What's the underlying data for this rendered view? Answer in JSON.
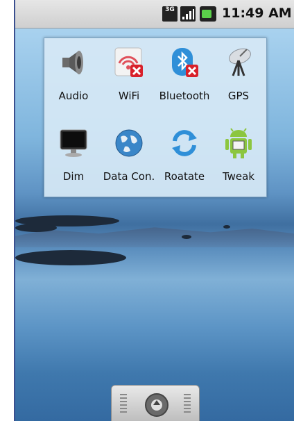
{
  "status_bar": {
    "network": "3G",
    "time": "11:49 AM"
  },
  "widget": {
    "tiles": [
      {
        "label": "Audio",
        "icon": "speaker-icon"
      },
      {
        "label": "WiFi",
        "icon": "wifi-icon"
      },
      {
        "label": "Bluetooth",
        "icon": "bluetooth-icon"
      },
      {
        "label": "GPS",
        "icon": "satellite-dish-icon"
      },
      {
        "label": "Dim",
        "icon": "monitor-icon"
      },
      {
        "label": "Data Con.",
        "icon": "globe-icon"
      },
      {
        "label": "Roatate",
        "icon": "rotate-arrows-icon"
      },
      {
        "label": "Tweak",
        "icon": "android-robot-icon"
      }
    ]
  },
  "colors": {
    "off_badge": "#d8202a",
    "bluetooth": "#2f8fd8",
    "android_green": "#8cc63f"
  }
}
